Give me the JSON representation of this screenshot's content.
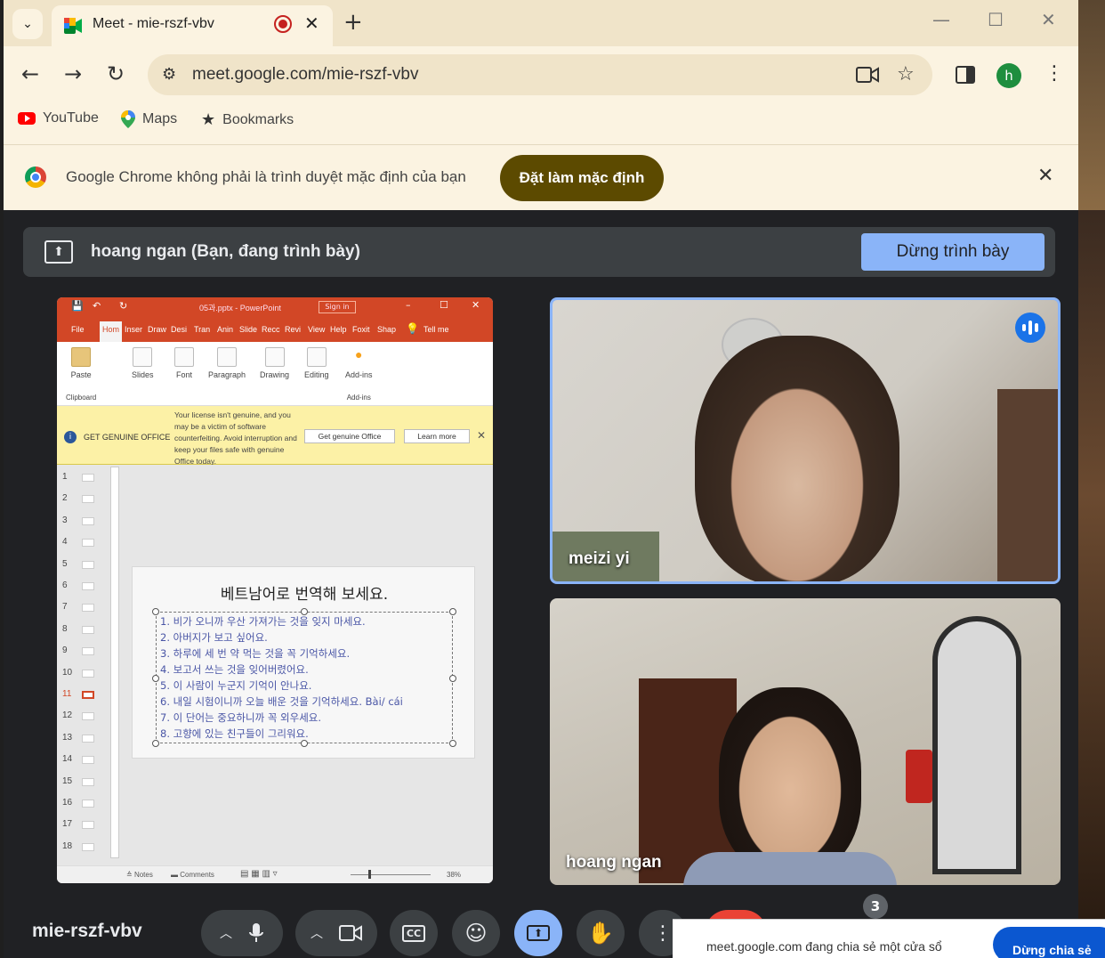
{
  "browser": {
    "tab_title": "Meet - mie-rszf-vbv",
    "tab_close": "✕",
    "new_tab": "+",
    "url": "meet.google.com/mie-rszf-vbv",
    "profile_initial": "h",
    "bookmarks": [
      {
        "label": "YouTube",
        "icon": "youtube-icon"
      },
      {
        "label": "Maps",
        "icon": "maps-pin-icon"
      },
      {
        "label": "Bookmarks",
        "icon": "star-icon"
      }
    ]
  },
  "infobar": {
    "message": "Google Chrome không phải là trình duyệt mặc định của bạn",
    "button": "Đặt làm mặc định"
  },
  "meet": {
    "presenting_banner": "hoang ngan (Bạn, đang trình bày)",
    "stop_presenting": "Dừng trình bày",
    "meeting_code": "mie-rszf-vbv",
    "participant_count": "3",
    "accent_color": "#8ab4f8",
    "participants": [
      {
        "name": "meizi yi",
        "speaking": true
      },
      {
        "name": "hoang ngan",
        "speaking": false
      }
    ],
    "share_notice": {
      "text": "meet.google.com đang chia sẻ một cửa sổ",
      "button": "Dừng chia sẻ"
    }
  },
  "powerpoint": {
    "file_title": "05과.pptx - PowerPoint",
    "sign_in": "Sign in",
    "tabs": [
      "File",
      "Hom",
      "Inser",
      "Draw",
      "Desi",
      "Tran",
      "Anin",
      "Slide",
      "Recc",
      "Revi",
      "View",
      "Help",
      "Foxit",
      "Shap",
      "Tell me"
    ],
    "ribbon_groups": [
      {
        "label": "Paste",
        "group": "Clipboard"
      },
      {
        "label": "Slides"
      },
      {
        "label": "Font"
      },
      {
        "label": "Paragraph"
      },
      {
        "label": "Drawing"
      },
      {
        "label": "Editing"
      },
      {
        "label": "Add-ins",
        "group": "Add-ins"
      }
    ],
    "warning": {
      "title": "GET GENUINE OFFICE",
      "body": "Your license isn't genuine, and you may be a victim of software counterfeiting. Avoid interruption and keep your files safe with genuine Office today.",
      "button_primary": "Get genuine Office",
      "button_secondary": "Learn more"
    },
    "thumbnail_numbers": [
      "1",
      "2",
      "3",
      "4",
      "5",
      "6",
      "7",
      "8",
      "9",
      "10",
      "11",
      "12",
      "13",
      "14",
      "15",
      "16",
      "17",
      "18"
    ],
    "selected_slide": "11",
    "slide": {
      "title": "베트남어로 번역해 보세요.",
      "lines": [
        "1.  비가 오니까 우산 가져가는 것을 잊지 마세요.",
        "2.  아버지가 보고 싶어요.",
        "3.  하루에 세 번 약 먹는 것을 꼭 기억하세요.",
        "4.  보고서 쓰는 것을 잊어버렸어요.",
        "5.  이 사람이 누군지 기억이 안나요.",
        "6.  내일 시험이니까 오늘 배운 것을 기억하세요. Bài/ cái",
        "7.  이 단어는 중요하니까 꼭 외우세요.",
        "8.  고향에 있는 친구들이 그리워요."
      ]
    },
    "status": {
      "notes": "Notes",
      "comments": "Comments",
      "zoom": "38%"
    }
  }
}
